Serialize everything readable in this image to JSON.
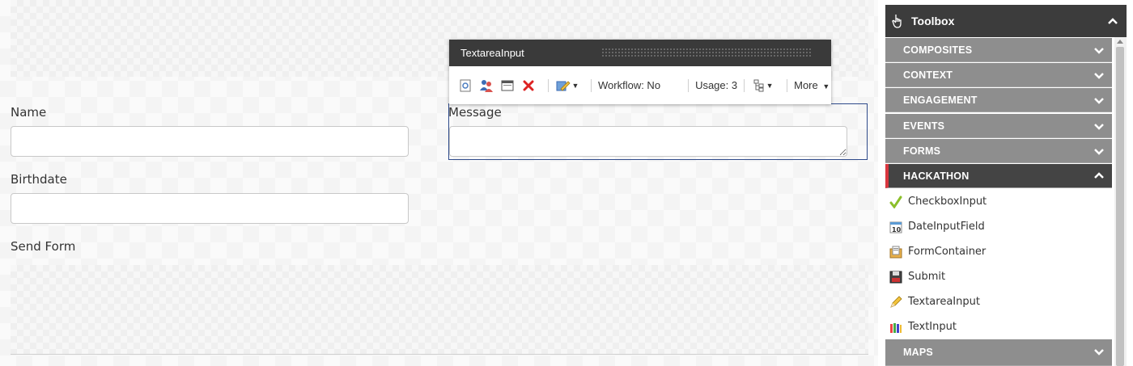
{
  "form": {
    "name_label": "Name",
    "name_value": "",
    "birthdate_label": "Birthdate",
    "birthdate_value": "",
    "message_label": "Message",
    "message_value": "",
    "send_label": "Send Form"
  },
  "chrome": {
    "title": "TextareaInput",
    "workflow": "Workflow: No",
    "usage": "Usage: 3",
    "more": "More"
  },
  "toolbox": {
    "title": "Toolbox",
    "categories": [
      {
        "label": "COMPOSITES"
      },
      {
        "label": "CONTEXT"
      },
      {
        "label": "ENGAGEMENT"
      },
      {
        "label": "EVENTS"
      },
      {
        "label": "FORMS"
      },
      {
        "label": "HACKATHON"
      },
      {
        "label": "MAPS"
      }
    ],
    "items": [
      {
        "label": "CheckboxInput",
        "icon": "checkmark-icon"
      },
      {
        "label": "DateInputField",
        "icon": "calendar-icon"
      },
      {
        "label": "FormContainer",
        "icon": "form-container-icon"
      },
      {
        "label": "Submit",
        "icon": "floppy-disk-icon"
      },
      {
        "label": "TextareaInput",
        "icon": "pencil-icon"
      },
      {
        "label": "TextInput",
        "icon": "crayons-icon"
      }
    ]
  },
  "colors": {
    "accent_red": "#d9363e",
    "selection_border": "#2e4a8a",
    "category_bg": "#8e8e8e",
    "header_bg": "#3c3c3c"
  }
}
